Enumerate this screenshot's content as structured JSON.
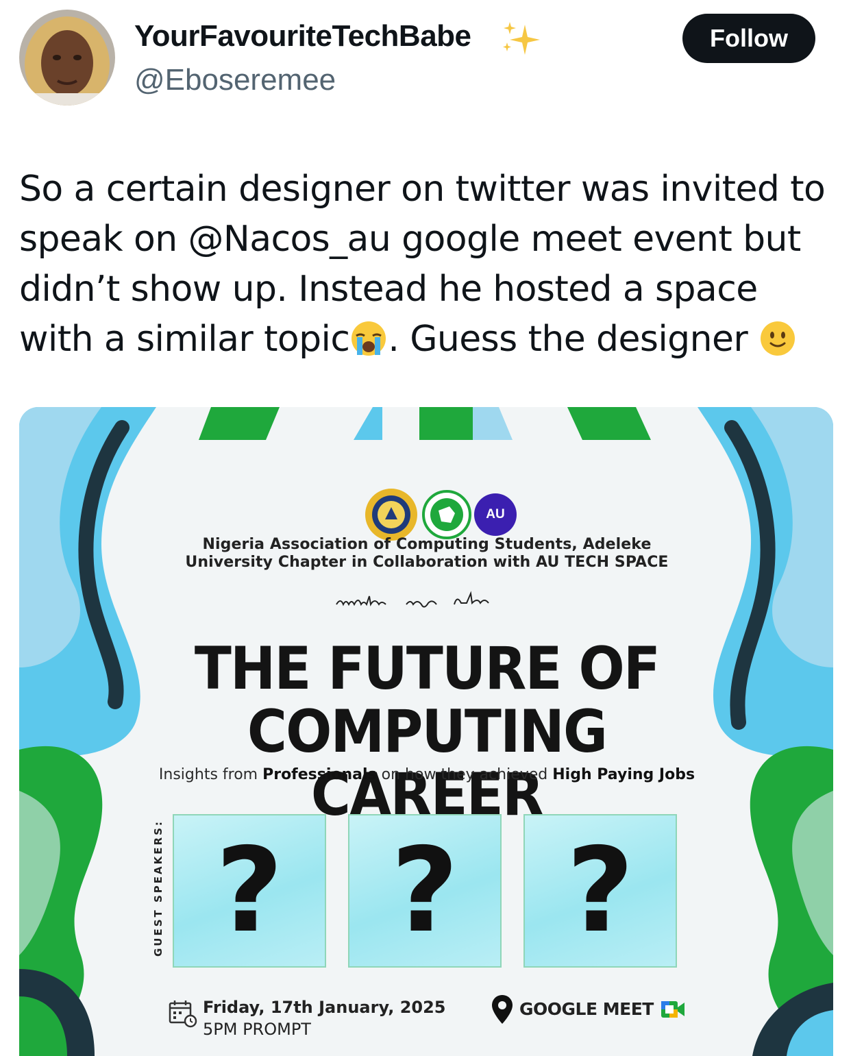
{
  "author": {
    "display_name": "YourFavouriteTechBabe",
    "handle": "@Eboseremee",
    "follow_label": "Follow"
  },
  "tweet": {
    "text_part1": "So a certain designer on twitter was invited to speak on @Nacos_au google meet event but didn’t show up. Instead he hosted a space with a similar topic",
    "text_part2": ". Guess the designer ",
    "emojis": [
      "loudly-crying-face",
      "slightly-smiling-face"
    ]
  },
  "flyer": {
    "logo_au_text": "AU",
    "org_line": "Nigeria Association of Computing Students, Adeleke University Chapter in Collaboration with AU TECH SPACE",
    "invites_text": "invites you to",
    "title": "THE FUTURE OF COMPUTING CAREER",
    "tagline": {
      "t1": "Insights from ",
      "b1": "Professionals",
      "t2": " on how they achieved ",
      "b2": "High Paying Jobs"
    },
    "guest_label": "GUEST SPEAKERS:",
    "speakers": [
      "?",
      "?",
      "?"
    ],
    "date": "Friday, 17th January, 2025",
    "time": "5PM PROMPT",
    "venue": "GOOGLE MEET"
  },
  "colors": {
    "green": "#1fa83c",
    "light_blue": "#5cc8ec",
    "dark_navy": "#1e3540",
    "follow_bg": "#0f1419",
    "handle_gray": "#536471"
  }
}
